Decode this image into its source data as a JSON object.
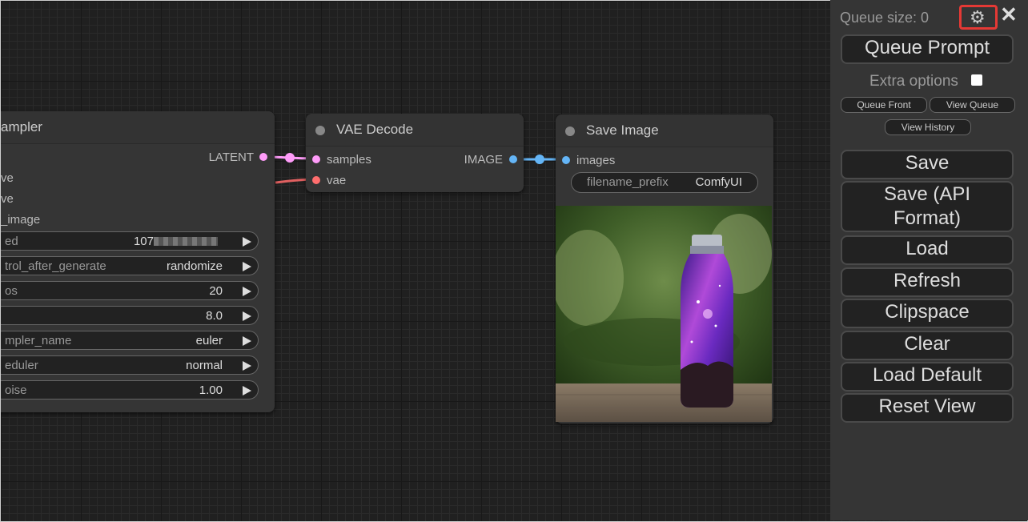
{
  "ksampler": {
    "title": "ampler",
    "output_label": "LATENT",
    "inputs": [
      "ve",
      "ve",
      "_image"
    ],
    "widgets": [
      {
        "label": "ed",
        "value": "107"
      },
      {
        "label": "trol_after_generate",
        "value": "randomize"
      },
      {
        "label": "os",
        "value": "20"
      },
      {
        "label": "",
        "value": "8.0"
      },
      {
        "label": "mpler_name",
        "value": "euler"
      },
      {
        "label": "eduler",
        "value": "normal"
      },
      {
        "label": "oise",
        "value": "1.00"
      }
    ]
  },
  "vae_decode": {
    "title": "VAE Decode",
    "input_samples": "samples",
    "input_vae": "vae",
    "output_label": "IMAGE"
  },
  "save_image": {
    "title": "Save Image",
    "input_images": "images",
    "filename_label": "filename_prefix",
    "filename_value": "ComfyUI"
  },
  "menu": {
    "queue_size": "Queue size: 0",
    "settings_icon": "gear-icon",
    "close_icon": "close-icon",
    "queue_prompt": "Queue Prompt",
    "extra_options": "Extra options",
    "queue_front": "Queue Front",
    "view_queue": "View Queue",
    "view_history": "View History",
    "save": "Save",
    "save_api": "Save (API Format)",
    "load": "Load",
    "refresh": "Refresh",
    "clipspace": "Clipspace",
    "clear": "Clear",
    "load_default": "Load Default",
    "reset_view": "Reset View"
  },
  "colors": {
    "latent": "#ff9cf9",
    "vae": "#ff6e6e",
    "image": "#64b5f6",
    "highlight": "#e53935"
  }
}
